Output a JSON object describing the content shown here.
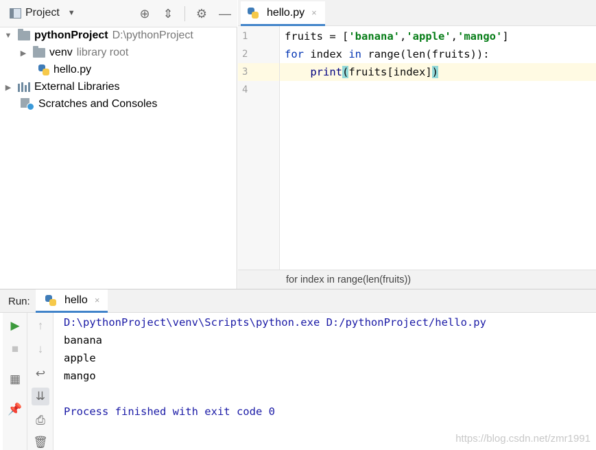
{
  "project": {
    "title": "Project",
    "tree": [
      {
        "name": "pythonProject",
        "path": "D:\\pythonProject"
      },
      {
        "name": "venv",
        "note": "library root"
      },
      {
        "name": "hello.py"
      },
      {
        "name": "External Libraries"
      },
      {
        "name": "Scratches and Consoles"
      }
    ]
  },
  "editor": {
    "tab": {
      "label": "hello.py",
      "close": "×"
    },
    "line_numbers": [
      "1",
      "2",
      "3",
      "4"
    ],
    "breadcrumb": "for index in range(len(fruits))",
    "code": {
      "l1_a": "fruits = [",
      "l1_s1": "'banana'",
      "l1_c1": ",",
      "l1_s2": "'apple'",
      "l1_c2": ",",
      "l1_s3": "'mango'",
      "l1_b": "]",
      "l2_kw1": "for",
      "l2_a": " index ",
      "l2_kw2": "in",
      "l2_b": " range(len(fruits)):",
      "l3_indent": "    ",
      "l3_fn": "print",
      "l3_open": "(",
      "l3_mid": "fruits[index]",
      "l3_close": ")"
    }
  },
  "run": {
    "label": "Run:",
    "tab": {
      "label": "hello",
      "close": "×"
    },
    "console": [
      "D:\\pythonProject\\venv\\Scripts\\python.exe D:/pythonProject/hello.py",
      "banana",
      "apple",
      "mango",
      "",
      "Process finished with exit code 0"
    ]
  },
  "watermark": "https://blog.csdn.net/zmr1991",
  "colors": {
    "accent": "#4083c9",
    "keyword": "#0033b3",
    "string": "#067d17",
    "console_blue": "#1a1aa6",
    "current_line": "#fffae3"
  }
}
